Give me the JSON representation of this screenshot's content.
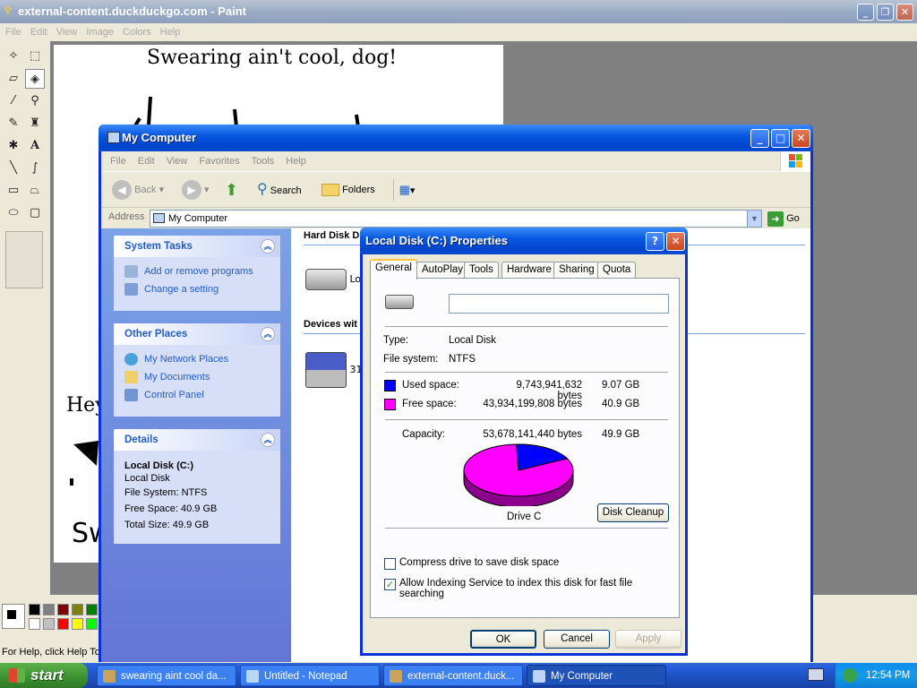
{
  "paint": {
    "title": "external-content.duckduckgo.com - Paint",
    "menu": [
      "File",
      "Edit",
      "View",
      "Image",
      "Colors",
      "Help"
    ],
    "canvas_texts": {
      "heading": "Swearing ain't cool, dog!",
      "mid": "Hey",
      "bottom": "Sw"
    },
    "status": "For Help, click Help Topics on the Help Menu.",
    "palette": [
      "#000000",
      "#808080",
      "#800000",
      "#808000",
      "#008000",
      "#ffffff",
      "#c0c0c0",
      "#ff0000",
      "#ffff00",
      "#00ff00"
    ]
  },
  "my_computer": {
    "title": "My Computer",
    "menu": [
      "File",
      "Edit",
      "View",
      "Favorites",
      "Tools",
      "Help"
    ],
    "toolbar": {
      "back": "Back",
      "search": "Search",
      "folders": "Folders"
    },
    "address": {
      "label": "Address",
      "value": "My Computer",
      "go": "Go"
    },
    "system_tasks": {
      "title": "System Tasks",
      "items": [
        "Add or remove programs",
        "Change a setting"
      ]
    },
    "other_places": {
      "title": "Other Places",
      "items": [
        "My Network Places",
        "My Documents",
        "Control Panel"
      ]
    },
    "details": {
      "title": "Details",
      "name": "Local Disk (C:)",
      "type": "Local Disk",
      "fs": "File System: NTFS",
      "free": "Free Space: 40.9 GB",
      "total": "Total Size: 49.9 GB"
    },
    "groups": {
      "hard_disks": "Hard Disk D",
      "devices": "Devices wit",
      "drive_label": "Lo",
      "floppy_label": "31"
    }
  },
  "dialog": {
    "title": "Local Disk (C:) Properties",
    "tabs": [
      "General",
      "AutoPlay",
      "Tools",
      "Hardware",
      "Sharing",
      "Quota"
    ],
    "label_value": "",
    "type": {
      "label": "Type:",
      "value": "Local Disk"
    },
    "fs": {
      "label": "File system:",
      "value": "NTFS"
    },
    "used": {
      "label": "Used space:",
      "bytes": "9,743,941,632 bytes",
      "gb": "9.07 GB",
      "color": "#0000ff"
    },
    "free": {
      "label": "Free space:",
      "bytes": "43,934,199,808 bytes",
      "gb": "40.9 GB",
      "color": "#ff00ff"
    },
    "capacity": {
      "label": "Capacity:",
      "bytes": "53,678,141,440 bytes",
      "gb": "49.9 GB"
    },
    "pie": {
      "used_fraction": 0.1815
    },
    "drive_caption": "Drive C",
    "cleanup_button": "Disk Cleanup",
    "compress_label": "Compress drive to save disk space",
    "compress_checked": false,
    "index_label": "Allow Indexing Service to index this disk for fast file searching",
    "index_checked": true,
    "buttons": {
      "ok": "OK",
      "cancel": "Cancel",
      "apply": "Apply"
    }
  },
  "taskbar": {
    "start": "start",
    "tasks": [
      "swearing aint cool da...",
      "Untitled - Notepad",
      "external-content.duck...",
      "My Computer"
    ],
    "clock": "12:54 PM"
  }
}
